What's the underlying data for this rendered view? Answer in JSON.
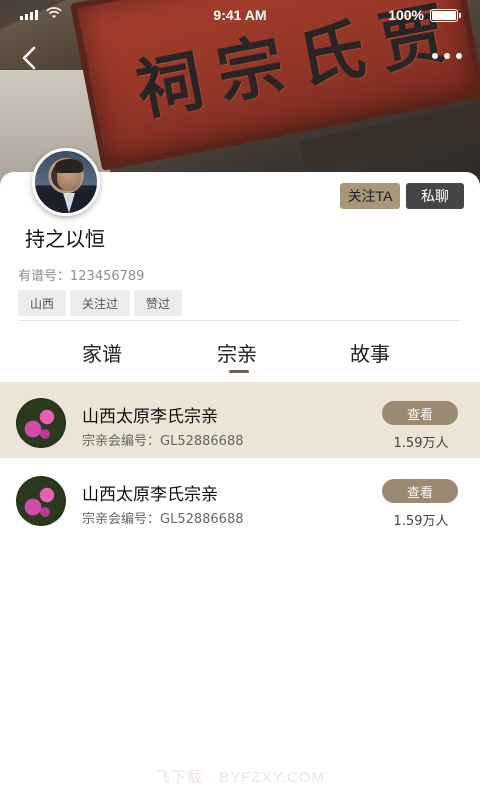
{
  "status_bar": {
    "time": "9:41 AM",
    "battery": "100%"
  },
  "banner": {
    "plaque_text": "贾氏宗祠"
  },
  "profile": {
    "username": "持之以恒",
    "pedigree_label": "有谱号：",
    "pedigree_number": "123456789",
    "follow_label": "关注TA",
    "message_label": "私聊",
    "tags": [
      "山西",
      "关注过",
      "赞过"
    ]
  },
  "tabs": [
    {
      "label": "家谱",
      "active": false
    },
    {
      "label": "宗亲",
      "active": true
    },
    {
      "label": "故事",
      "active": false
    }
  ],
  "clan_list": [
    {
      "title": "山西太原李氏宗亲",
      "code_label": "宗亲会编号：",
      "code": "GL52886688",
      "button": "查看",
      "count": "1.59万人",
      "highlighted": true
    },
    {
      "title": "山西太原李氏宗亲",
      "code_label": "宗亲会编号：",
      "code": "GL52886688",
      "button": "查看",
      "count": "1.59万人",
      "highlighted": false
    }
  ],
  "watermark": "飞下载 · BYFZXY.COM",
  "colors": {
    "accent": "#9a8a72",
    "highlight_row": "#ede4d8",
    "follow_button": "#a9977a",
    "chat_button": "#454545"
  },
  "icons": {
    "back": "chevron-left-icon",
    "more": "more-horizontal-icon",
    "signal": "signal-icon",
    "wifi": "wifi-icon",
    "battery": "battery-icon"
  }
}
